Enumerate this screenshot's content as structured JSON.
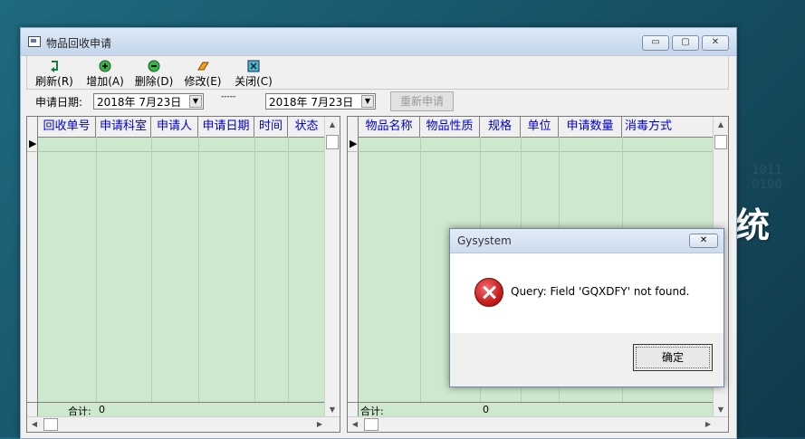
{
  "background": {
    "big_text": "统"
  },
  "window": {
    "title": "物品回收申请",
    "controls": {
      "minimize": "▭",
      "maximize": "▢",
      "close": "✕"
    }
  },
  "toolbar": [
    {
      "name": "refresh",
      "label": "刷新(R)",
      "icon": "refresh-icon"
    },
    {
      "name": "add",
      "label": "增加(A)",
      "icon": "plus-icon"
    },
    {
      "name": "delete",
      "label": "删除(D)",
      "icon": "minus-icon"
    },
    {
      "name": "edit",
      "label": "修改(E)",
      "icon": "eraser-icon"
    },
    {
      "name": "close",
      "label": "关闭(C)",
      "icon": "close-icon"
    }
  ],
  "filter": {
    "date_label": "申请日期:",
    "date_from": "2018年 7月23日",
    "separator": "-----",
    "date_to": "2018年 7月23日",
    "reapply_button": "重新申请"
  },
  "left_grid": {
    "columns": [
      "回收单号",
      "申请科室",
      "申请人",
      "申请日期",
      "时间",
      "状态"
    ],
    "footer_label": "合计:",
    "footer_value": "0"
  },
  "right_grid": {
    "columns": [
      "物品名称",
      "物品性质",
      "规格",
      "单位",
      "申请数量",
      "消毒方式"
    ],
    "footer_label": "合计:",
    "footer_value": "0"
  },
  "dialog": {
    "title": "Gysystem",
    "close": "✕",
    "message": "Query: Field 'GQXDFY' not found.",
    "ok_button": "确定"
  }
}
